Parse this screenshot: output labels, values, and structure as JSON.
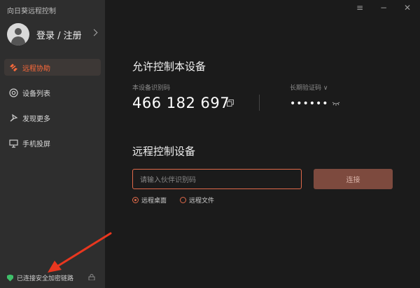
{
  "app": {
    "title": "向日葵远程控制"
  },
  "user": {
    "login_label": "登录 / 注册"
  },
  "sidebar": {
    "items": [
      {
        "label": "远程协助",
        "icon": "remote-assist-icon",
        "active": true
      },
      {
        "label": "设备列表",
        "icon": "device-list-icon",
        "active": false
      },
      {
        "label": "发现更多",
        "icon": "discover-icon",
        "active": false
      },
      {
        "label": "手机投屏",
        "icon": "screen-cast-icon",
        "active": false
      }
    ],
    "status_text": "已连接安全加密链路"
  },
  "main": {
    "allow_section": {
      "title": "允许控制本设备",
      "device_id_label": "本设备识别码",
      "device_id": "466 182 697",
      "password_label": "长期验证码 ∨",
      "password_masked": "••••••"
    },
    "remote_section": {
      "title": "远程控制设备",
      "input_placeholder": "请输入伙伴识别码",
      "connect_label": "连接",
      "options": [
        {
          "label": "远程桌面",
          "selected": true
        },
        {
          "label": "远程文件",
          "selected": false
        }
      ]
    }
  },
  "colors": {
    "accent": "#ff6a3a",
    "input_border": "#e06a4a",
    "connect_bg": "#7d4a3e",
    "secure": "#3fbf6a",
    "annotation_arrow": "#e8371f"
  }
}
